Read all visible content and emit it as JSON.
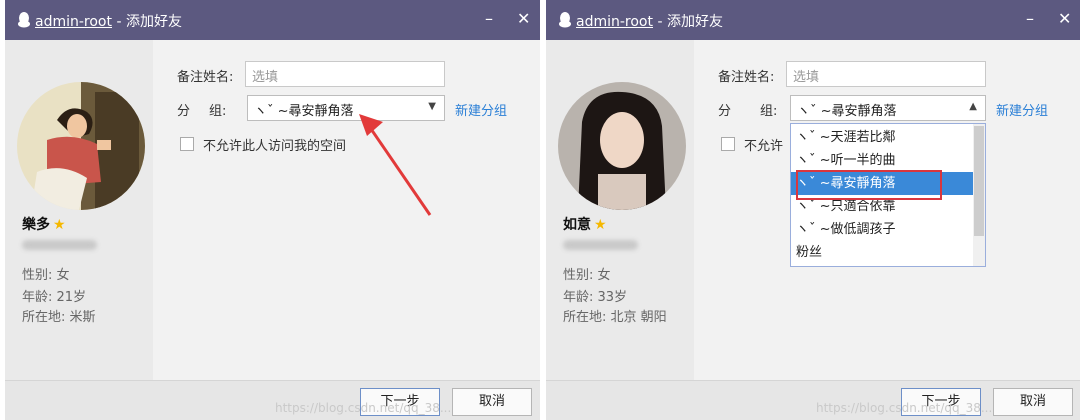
{
  "windows": [
    {
      "title_user": "admin-root",
      "title_suffix": " - 添加好友",
      "minimize": "–",
      "close": "✕",
      "profile": {
        "name": "樂多",
        "gender": "性别: 女",
        "age": "年龄: 21岁",
        "location": "所在地: 米斯"
      },
      "form": {
        "note_label": "备注姓名:",
        "note_placeholder": "选填",
        "group_label_a": "分",
        "group_label_b": "组:",
        "group_value": "ヽˇ ~尋安靜角落",
        "new_group": "新建分组",
        "privacy_label": "不允许此人访问我的空间"
      },
      "buttons": {
        "next": "下一步",
        "cancel": "取消"
      },
      "watermark": "https://blog.csdn.net/qq_38..."
    },
    {
      "title_user": "admin-root",
      "title_suffix": " - 添加好友",
      "minimize": "–",
      "close": "✕",
      "profile": {
        "name": "如意",
        "gender": "性别: 女",
        "age": "年龄: 33岁",
        "location": "所在地: 北京  朝阳"
      },
      "form": {
        "note_label": "备注姓名:",
        "note_placeholder": "选填",
        "group_label_a": "分",
        "group_label_b": "组:",
        "group_value": "ヽˇ ~尋安靜角落",
        "new_group": "新建分组",
        "privacy_label": "不允许"
      },
      "dropdown": [
        "ヽˇ ~天涯若比鄰",
        "ヽˇ ~听一半的曲",
        "ヽˇ ~尋安靜角落",
        "ヽˇ ~只適合依靠",
        "ヽˇ ~做低調孩子",
        "粉丝"
      ],
      "buttons": {
        "next": "下一步",
        "cancel": "取消"
      },
      "watermark": "https://blog.csdn.net/qq_38..."
    }
  ],
  "colors": {
    "titlebar": "#5c5980",
    "link": "#2a7fd6",
    "selection": "#3a89d8",
    "highlight": "#d9363e"
  }
}
